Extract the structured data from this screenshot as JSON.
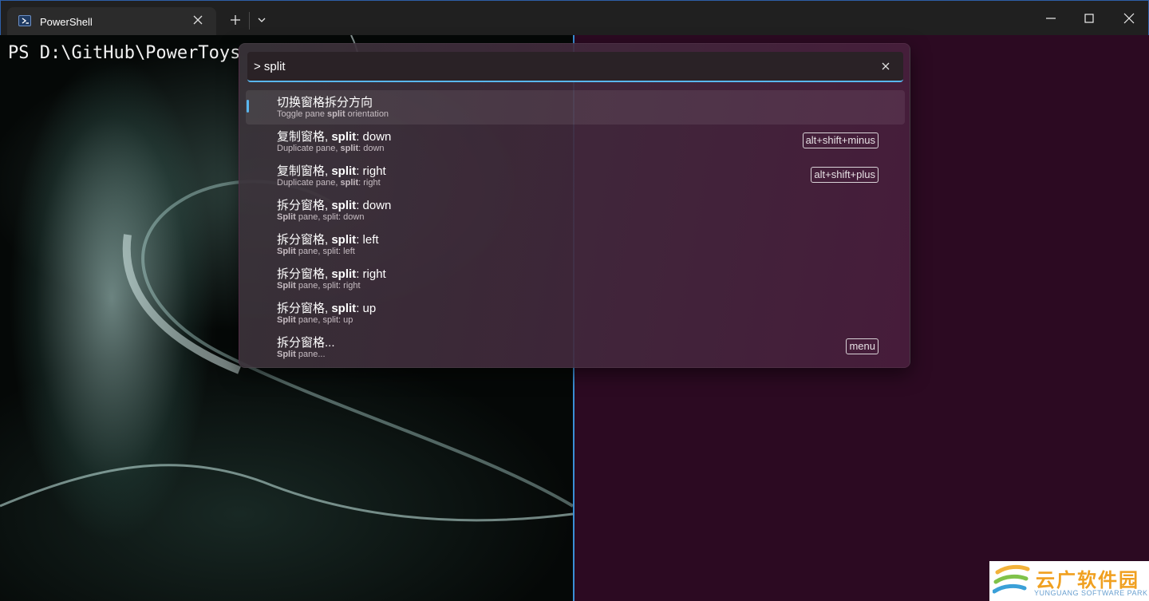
{
  "tab": {
    "title": "PowerShell",
    "icon": "powershell-icon"
  },
  "titlebar": {
    "new_tab_icon": "plus-icon",
    "dropdown_icon": "chevron-down-icon"
  },
  "window_controls": {
    "minimize": "minimize-icon",
    "maximize": "maximize-icon",
    "close": "close-icon"
  },
  "terminal": {
    "prompt": "PS D:\\GitHub\\PowerToys"
  },
  "palette": {
    "search_value": "> split",
    "accent_color": "#59b6ee",
    "items": [
      {
        "title_parts": [
          "切换窗格拆分方向"
        ],
        "sub_parts": [
          "Toggle pane ",
          "split",
          " orientation"
        ],
        "key": ""
      },
      {
        "title_parts": [
          "复制窗格, ",
          "split",
          ": down"
        ],
        "sub_parts": [
          "Duplicate pane, ",
          "split",
          ": down"
        ],
        "key": "alt+shift+minus"
      },
      {
        "title_parts": [
          "复制窗格, ",
          "split",
          ": right"
        ],
        "sub_parts": [
          "Duplicate pane, ",
          "split",
          ": right"
        ],
        "key": "alt+shift+plus"
      },
      {
        "title_parts": [
          "拆分窗格, ",
          "split",
          ": down"
        ],
        "sub_parts": [
          "",
          "Split",
          " pane, split: down"
        ],
        "key": ""
      },
      {
        "title_parts": [
          "拆分窗格, ",
          "split",
          ": left"
        ],
        "sub_parts": [
          "",
          "Split",
          " pane, split: left"
        ],
        "key": ""
      },
      {
        "title_parts": [
          "拆分窗格, ",
          "split",
          ": right"
        ],
        "sub_parts": [
          "",
          "Split",
          " pane, split: right"
        ],
        "key": ""
      },
      {
        "title_parts": [
          "拆分窗格, ",
          "split",
          ": up"
        ],
        "sub_parts": [
          "",
          "Split",
          " pane, split: up"
        ],
        "key": ""
      },
      {
        "title_parts": [
          "拆分窗格..."
        ],
        "sub_parts": [
          "",
          "Split",
          " pane..."
        ],
        "key": "menu"
      }
    ]
  },
  "watermark": {
    "cn": "云广软件园",
    "en": "YUNGUANG SOFTWARE PARK"
  }
}
